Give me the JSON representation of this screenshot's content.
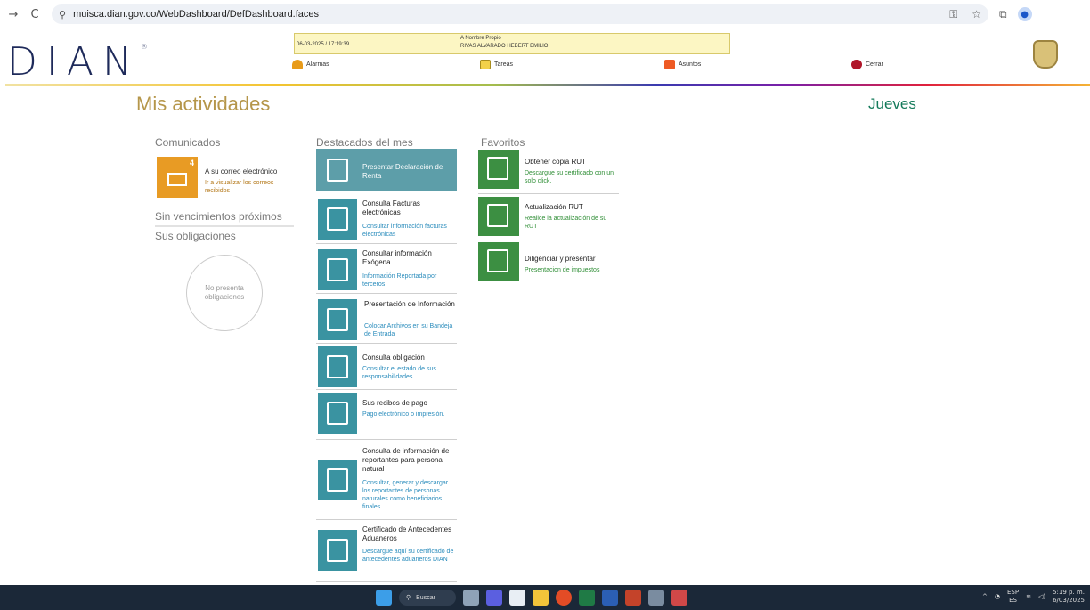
{
  "browser": {
    "url": "muisca.dian.gov.co/WebDashboard/DefDashboard.faces",
    "back_icon": "→",
    "reload_icon": "C",
    "site_icon": "⚲"
  },
  "header": {
    "logo_text": "DIAN",
    "logo_mark": "®",
    "session_date": "06-03-2025 / 17:19:39",
    "user_label": "A Nombre Propio",
    "user_name": "RIVAS ALVARADO HEBERT EMILIO",
    "menu": {
      "alarmas": "Alarmas",
      "tareas": "Tareas",
      "asuntos": "Asuntos",
      "cerrar": "Cerrar"
    }
  },
  "page": {
    "title": "Mis actividades",
    "day": "Jueves"
  },
  "comunicados": {
    "heading": "Comunicados",
    "count": "4",
    "mail_title": "A su correo electrónico",
    "mail_sub": "Ir a visualizar los correos recibidos",
    "sin_vencimientos": "Sin vencimientos próximos",
    "obligaciones": "Sus obligaciones",
    "no_obligaciones": "No presenta obligaciones"
  },
  "destacados": {
    "heading": "Destacados del mes",
    "items": [
      {
        "title": "Presentar Declaración de Renta",
        "sub": ""
      },
      {
        "title": "Consulta Facturas electrónicas",
        "sub": "Consultar información facturas electrónicas"
      },
      {
        "title": "Consultar información Exógena",
        "sub": "Información Reportada por terceros"
      },
      {
        "title": "Presentación de Información",
        "sub": "Colocar Archivos en su Bandeja de Entrada"
      },
      {
        "title": "Consulta obligación",
        "sub": "Consultar el estado de sus responsabilidades."
      },
      {
        "title": "Sus recibos de pago",
        "sub": "Pago electrónico o impresión."
      },
      {
        "title": "Consulta de información de reportantes para persona natural",
        "sub": "Consultar, generar y descargar los reportantes de personas naturales como beneficiarios finales"
      },
      {
        "title": "Certificado de Antecedentes Aduaneros",
        "sub": "Descargue aquí su certificado de antecedentes aduaneros DIAN"
      }
    ]
  },
  "favoritos": {
    "heading": "Favoritos",
    "items": [
      {
        "title": "Obtener copia RUT",
        "sub": "Descargue su certificado con un solo click."
      },
      {
        "title": "Actualización RUT",
        "sub": "Realice la actualización de su RUT"
      },
      {
        "title": "Diligenciar y presentar",
        "sub": "Presentacion de impuestos"
      }
    ]
  },
  "taskbar": {
    "search": "Buscar",
    "lang_top": "ESP",
    "lang_bottom": "ES",
    "time": "5:19 p. m.",
    "date": "6/03/2025"
  },
  "colors": {
    "gold": "#b5964a",
    "teal_tile": "#3a93a1",
    "green_tile": "#3c8f42",
    "orange_tile": "#e89b24"
  }
}
